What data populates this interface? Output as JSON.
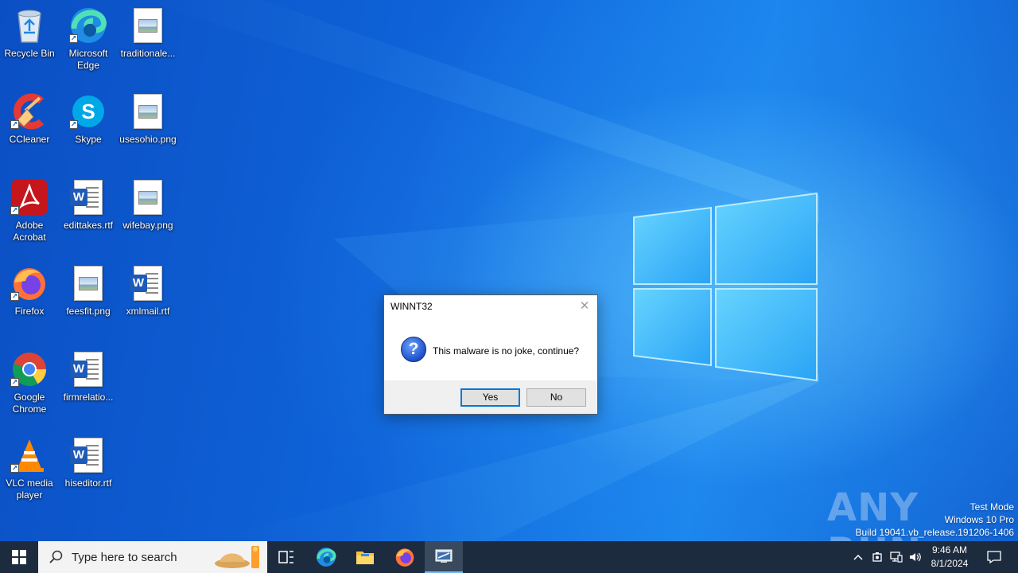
{
  "desktop": {
    "icons": [
      {
        "label": "Recycle Bin",
        "icon": "recycle-bin-icon"
      },
      {
        "label": "Microsoft Edge",
        "icon": "edge-icon"
      },
      {
        "label": "traditionale...",
        "icon": "image-file-icon"
      },
      {
        "label": "CCleaner",
        "icon": "ccleaner-icon"
      },
      {
        "label": "Skype",
        "icon": "skype-icon"
      },
      {
        "label": "usesohio.png",
        "icon": "image-file-icon"
      },
      {
        "label": "Adobe Acrobat",
        "icon": "acrobat-icon"
      },
      {
        "label": "edittakes.rtf",
        "icon": "word-file-icon"
      },
      {
        "label": "wifebay.png",
        "icon": "image-file-icon"
      },
      {
        "label": "Firefox",
        "icon": "firefox-icon"
      },
      {
        "label": "feesfit.png",
        "icon": "image-file-icon"
      },
      {
        "label": "xmlmail.rtf",
        "icon": "word-file-icon"
      },
      {
        "label": "Google Chrome",
        "icon": "chrome-icon"
      },
      {
        "label": "firmrelatio...",
        "icon": "word-file-icon"
      },
      {
        "label": "VLC media player",
        "icon": "vlc-icon"
      },
      {
        "label": "hiseditor.rtf",
        "icon": "word-file-icon"
      }
    ]
  },
  "dialog": {
    "title": "WINNT32",
    "message": "This malware is no joke, continue?",
    "yes_label": "Yes",
    "no_label": "No",
    "close_glyph": "✕"
  },
  "watermark": {
    "logo": "ANY RUN",
    "line1": "Test Mode",
    "line2": "Windows 10 Pro",
    "line3": "Build 19041.vb_release.191206-1406"
  },
  "taskbar": {
    "search_placeholder": "Type here to search",
    "time": "9:46 AM",
    "date": "8/1/2024",
    "pinned": [
      "task-view-icon",
      "edge-icon",
      "file-explorer-icon",
      "firefox-icon",
      "winnt32-app-icon"
    ]
  },
  "colors": {
    "taskbar_bg": "#1c2b3e",
    "dialog_default_border": "#0078d7"
  }
}
